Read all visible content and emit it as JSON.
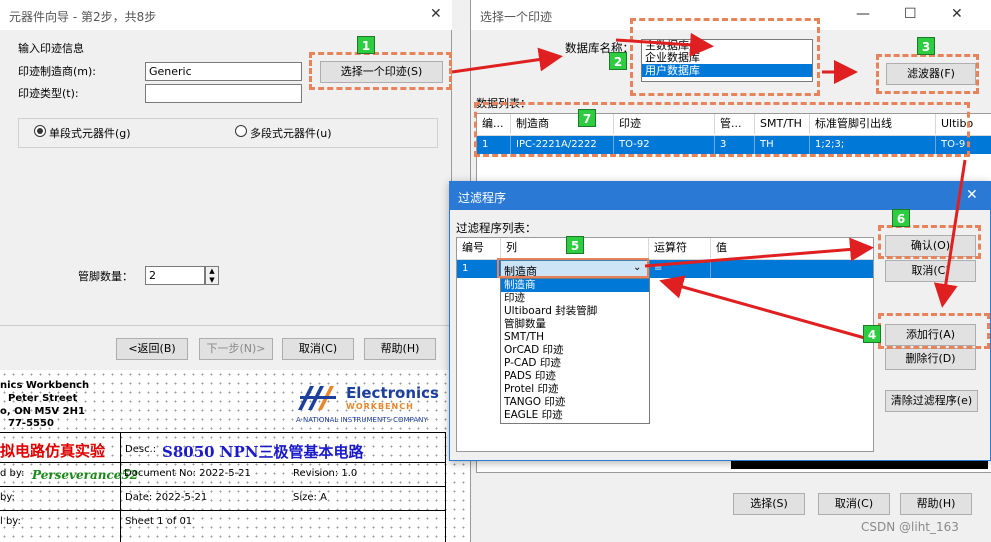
{
  "wizard": {
    "title": "元器件向导 - 第2步，共8步",
    "section_label": "输入印迹信息",
    "manufacturer_label": "印迹制造商(m):",
    "manufacturer_value": "Generic",
    "type_label": "印迹类型(t):",
    "type_value": "",
    "select_button": "选择一个印迹(S)",
    "radio_single": "单段式元器件(g)",
    "radio_multi": "多段式元器件(u)",
    "pin_count_label": "管脚数量：",
    "pin_count_value": "2",
    "buttons": {
      "back": "<返回(B)",
      "next": "下一步(N)>",
      "cancel": "取消(C)",
      "help": "帮助(H)"
    }
  },
  "select_dialog": {
    "title": "选择一个印迹",
    "db_label": "数据库名称：",
    "databases": [
      "主数据库",
      "企业数据库",
      "用户数据库"
    ],
    "filter_button": "滤波器(F)",
    "list_label": "数据列表：",
    "columns": [
      "编...",
      "制造商",
      "印迹",
      "管...",
      "SMT/TH",
      "标准管脚引出线",
      "Ultibo"
    ],
    "row": [
      "1",
      "IPC-2221A/2222",
      "TO-92",
      "3",
      "TH",
      "1;2;3;",
      "TO-9"
    ],
    "buttons": {
      "select": "选择(S)",
      "cancel": "取消(C)",
      "help": "帮助(H)"
    }
  },
  "filter_dialog": {
    "title": "过滤程序",
    "list_label": "过滤程序列表：",
    "columns": [
      "编号",
      "列",
      "运算符",
      "值"
    ],
    "row_number": "1",
    "selected_column": "制造商",
    "operator": "=",
    "options": [
      "制造商",
      "印迹",
      "Ultiboard 封装管脚",
      "管脚数量",
      "SMT/TH",
      "OrCAD 印迹",
      "P-CAD 印迹",
      "PADS 印迹",
      "Protel 印迹",
      "TANGO 印迹",
      "EAGLE 印迹"
    ],
    "buttons": {
      "confirm": "确认(O)",
      "cancel": "取消(C)",
      "add_row": "添加行(A)",
      "delete_row": "删除行(D)",
      "clear": "清除过滤程序(e)"
    }
  },
  "sheet": {
    "company_lines": [
      "nics Workbench",
      "Peter Street",
      "o, ON M5V 2H1",
      "77-5550"
    ],
    "logo_text": "Electronics",
    "logo_sub": "WORKBENCH",
    "logo_tagline": "A NATIONAL INSTRUMENTS COMPANY",
    "project_name": "拟电路仿真实验",
    "desc_label": "Desc.:",
    "desc_value": "S8050 NPN三极管基本电路",
    "by_label": "d by:",
    "author": "Perseverance52",
    "doc_no": "Document No: 2022-5-21",
    "revision": "Revision: 1.0",
    "by2_label": "by:",
    "date": "Date: 2022-5-21",
    "size": "Size: A",
    "by3_label": "l by:",
    "sheet": "Sheet 1 of 01"
  },
  "callouts": [
    "1",
    "2",
    "3",
    "4",
    "5",
    "6",
    "7"
  ],
  "watermark": "CSDN @liht_163",
  "colors": {
    "highlight": "#0078d7",
    "callout": "#e8825a",
    "badge": "#2ecc40",
    "arrow": "#e02020",
    "title_red": "#e00000",
    "desc_blue": "#1a1acc"
  }
}
